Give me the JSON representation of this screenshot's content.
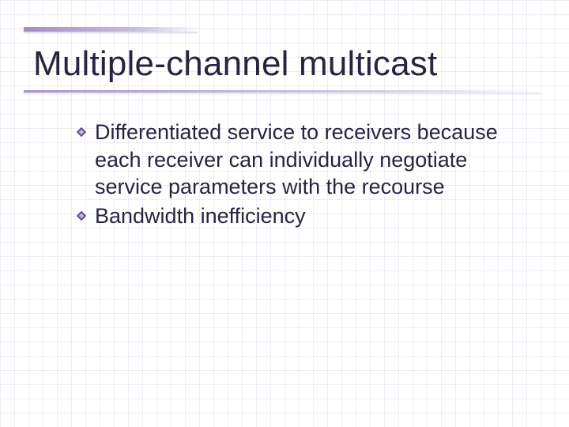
{
  "slide": {
    "title": "Multiple-channel multicast",
    "bullets": [
      "Differentiated service to receivers because each receiver can individually negotiate service parameters with the recourse",
      "Bandwidth inefficiency"
    ]
  },
  "icons": {
    "bullet": "diamond-bullet-icon"
  },
  "colors": {
    "accent": "#7d5fa8",
    "text": "#2a2340"
  }
}
